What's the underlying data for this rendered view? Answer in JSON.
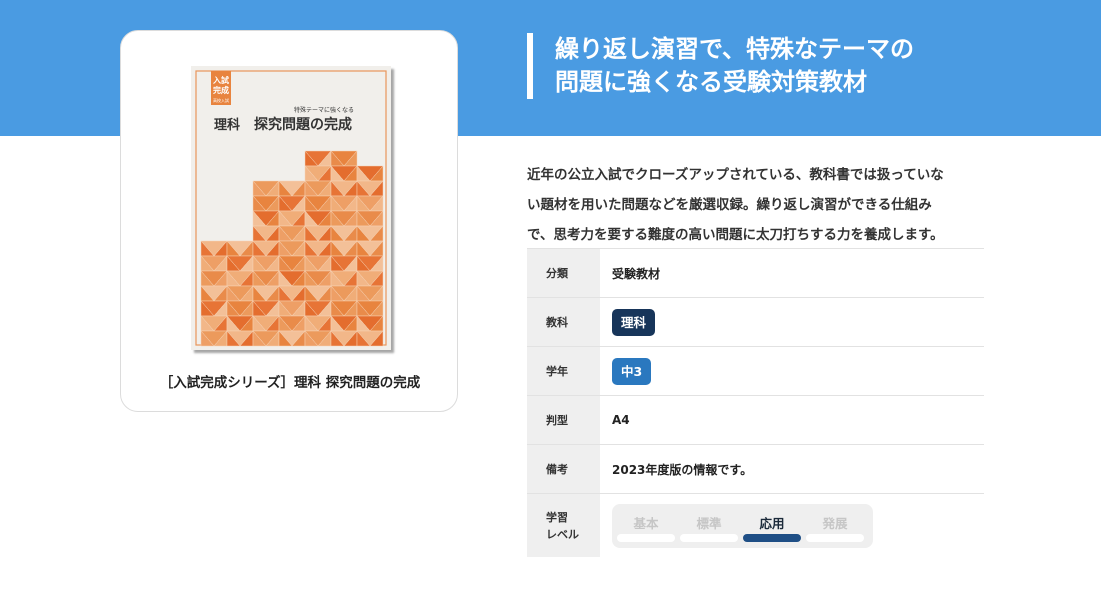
{
  "header": {
    "headline_line1": "繰り返し演習で、特殊なテーマの",
    "headline_line2": "問題に強くなる受験対策教材"
  },
  "product": {
    "cover": {
      "series_badge_line1": "入試",
      "series_badge_line2": "完成",
      "series_badge_sub": "高校入試",
      "subtitle": "特殊テーマに強くなる",
      "subject": "理科",
      "title": "探究問題の完成"
    },
    "caption": "［入試完成シリーズ］理科 探究問題の完成"
  },
  "description": [
    "近年の公立入試でクローズアップされている、教科書では扱っていな",
    "い題材を用いた問題などを厳選収録。繰り返し演習ができる仕組み",
    "で、思考力を要する難度の高い問題に太刀打ちする力を養成します。"
  ],
  "spec": {
    "category": {
      "label": "分類",
      "value": "受験教材"
    },
    "subject": {
      "label": "教科",
      "value": "理科",
      "color": "#17355a"
    },
    "grade": {
      "label": "学年",
      "value": "中3",
      "color": "#2a78bf"
    },
    "format": {
      "label": "判型",
      "value": "A4"
    },
    "note": {
      "label": "備考",
      "value": "2023年度版の情報です。"
    },
    "level": {
      "label_line1": "学習",
      "label_line2": "レベル",
      "options": [
        "基本",
        "標準",
        "応用",
        "発展"
      ],
      "selected": "応用"
    }
  },
  "colors": {
    "header_bg": "#4a9be2",
    "cover_orange": "#e8843f",
    "active_level": "#1f4f86"
  }
}
